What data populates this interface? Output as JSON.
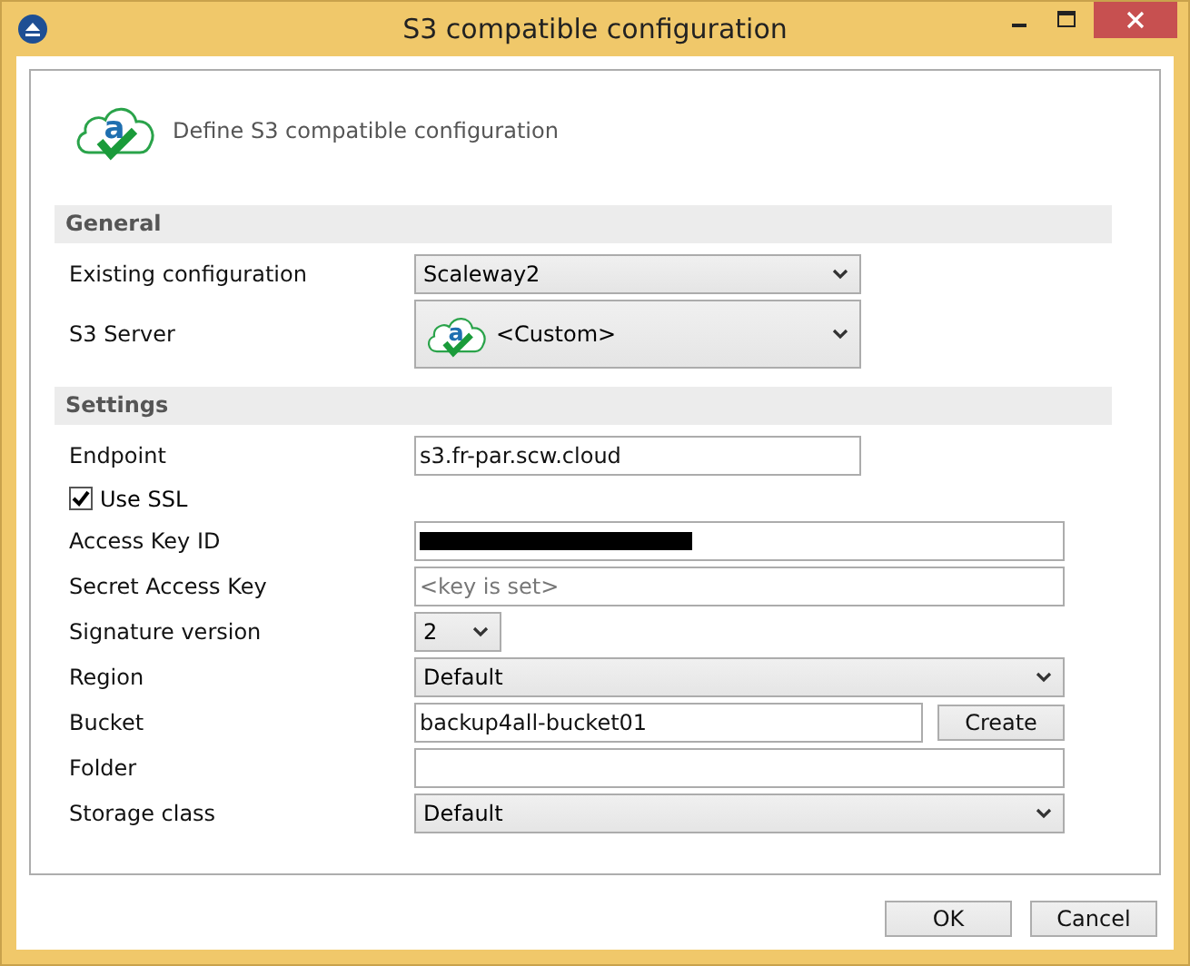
{
  "window": {
    "title": "S3 compatible configuration"
  },
  "header": {
    "logo_letter": "a",
    "text": "Define S3 compatible configuration"
  },
  "sections": [
    {
      "title": "General",
      "rows": [
        {
          "kind": "dropdown",
          "label": "Existing configuration",
          "value": "Scaleway2"
        },
        {
          "kind": "server",
          "label": "S3 Server",
          "logo_letter": "a",
          "value": "<Custom>"
        }
      ]
    },
    {
      "title": "Settings",
      "rows": [
        {
          "kind": "field",
          "label": "Endpoint",
          "value": "s3.fr-par.scw.cloud"
        },
        {
          "kind": "checkbox",
          "label": "Use SSL",
          "checked": true
        },
        {
          "kind": "redacted",
          "label": "Access Key ID"
        },
        {
          "kind": "field",
          "label": "Secret Access Key",
          "placeholder": "<key is set>"
        },
        {
          "kind": "dropdown",
          "label": "Signature version",
          "value": "2"
        },
        {
          "kind": "dropdown",
          "label": "Region",
          "value": "Default"
        },
        {
          "kind": "field_button",
          "label": "Bucket",
          "value": "backup4all-bucket01",
          "button": "Create"
        },
        {
          "kind": "field",
          "label": "Folder"
        },
        {
          "kind": "dropdown",
          "label": "Storage class",
          "value": "Default"
        }
      ]
    }
  ],
  "buttons": [
    {
      "label": "OK"
    },
    {
      "label": "Cancel"
    }
  ]
}
